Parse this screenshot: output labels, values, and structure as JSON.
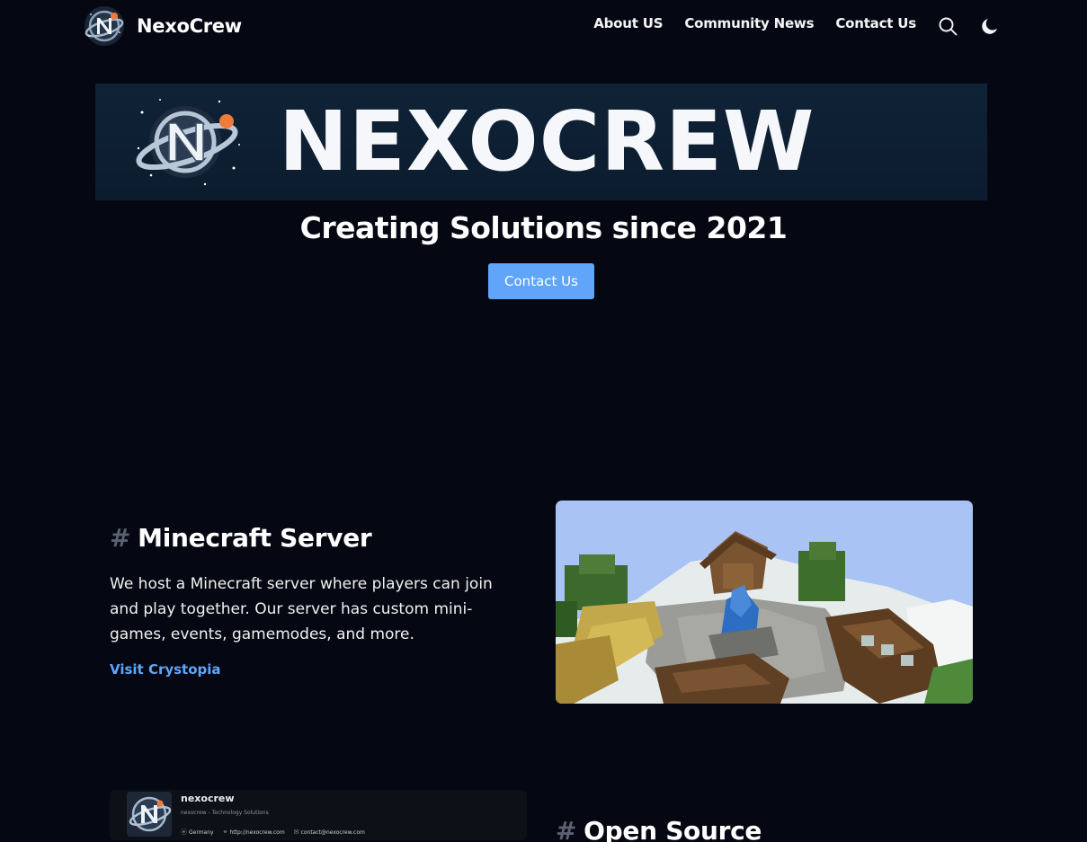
{
  "nav": {
    "brand": "NexoCrew",
    "links": [
      {
        "label": "About US"
      },
      {
        "label": "Community News"
      },
      {
        "label": "Contact Us"
      }
    ],
    "search_icon": "search-icon",
    "theme_icon": "moon-icon"
  },
  "hero": {
    "banner_text": "NEXOCREW",
    "title": "Creating Solutions since 2021",
    "button_label": "Contact Us"
  },
  "minecraft": {
    "hash": "#",
    "title": "Minecraft Server",
    "description": "We host a Minecraft server where players can join and play together. Our server has custom mini-games, events, gamemodes, and more.",
    "link": "Visit Crystopia"
  },
  "github_card": {
    "name": "nexocrew",
    "description": "nexocrew - Technology Solutions",
    "location": "Germany",
    "website": "http://nexocrew.com",
    "email": "contact@nexocrew.com"
  },
  "open_source": {
    "hash": "#",
    "title": "Open Source"
  },
  "colors": {
    "background": "#050812",
    "accent": "#60a5fa",
    "banner": "#0d1f33",
    "card": "#0d1117"
  }
}
